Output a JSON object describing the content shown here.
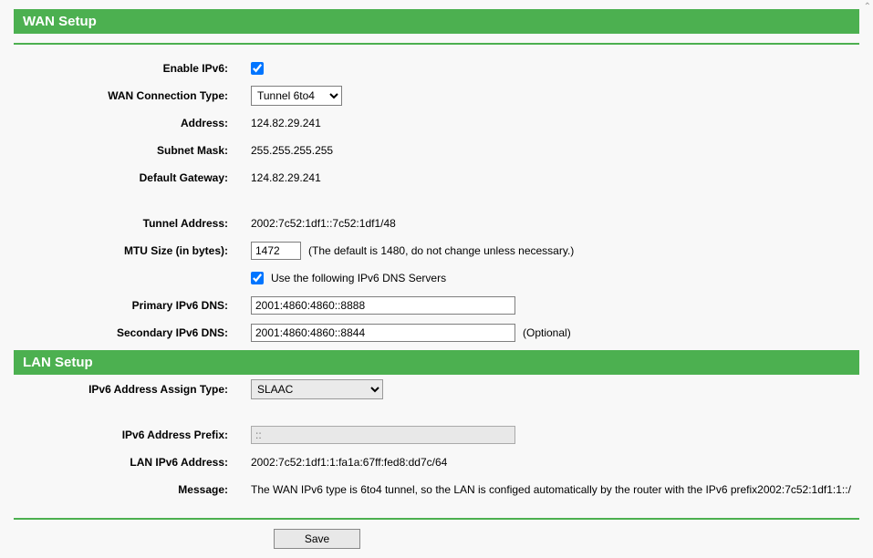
{
  "wan": {
    "header": "WAN Setup",
    "labels": {
      "enable_ipv6": "Enable IPv6:",
      "wan_conn_type": "WAN Connection Type:",
      "address": "Address:",
      "subnet_mask": "Subnet Mask:",
      "default_gateway": "Default Gateway:",
      "tunnel_address": "Tunnel Address:",
      "mtu_size": "MTU Size (in bytes):",
      "use_dns": "Use the following IPv6 DNS Servers",
      "primary_dns": "Primary IPv6 DNS:",
      "secondary_dns": "Secondary IPv6 DNS:"
    },
    "values": {
      "wan_conn_type": "Tunnel 6to4",
      "address": "124.82.29.241",
      "subnet_mask": "255.255.255.255",
      "default_gateway": "124.82.29.241",
      "tunnel_address": "2002:7c52:1df1::7c52:1df1/48",
      "mtu_size": "1472",
      "mtu_hint": "(The default is 1480, do not change unless necessary.)",
      "primary_dns": "2001:4860:4860::8888",
      "secondary_dns": "2001:4860:4860::8844",
      "secondary_hint": "(Optional)"
    }
  },
  "lan": {
    "header": "LAN Setup",
    "labels": {
      "assign_type": "IPv6 Address Assign Type:",
      "prefix": "IPv6 Address Prefix:",
      "lan_ipv6": "LAN IPv6 Address:",
      "message": "Message:"
    },
    "values": {
      "assign_type": "SLAAC",
      "prefix": "::",
      "lan_ipv6": "2002:7c52:1df1:1:fa1a:67ff:fed8:dd7c/64",
      "message": "The WAN IPv6 type is 6to4 tunnel, so the LAN is configed automatically by the router with the IPv6 prefix2002:7c52:1df1:1::/"
    }
  },
  "buttons": {
    "save": "Save"
  }
}
